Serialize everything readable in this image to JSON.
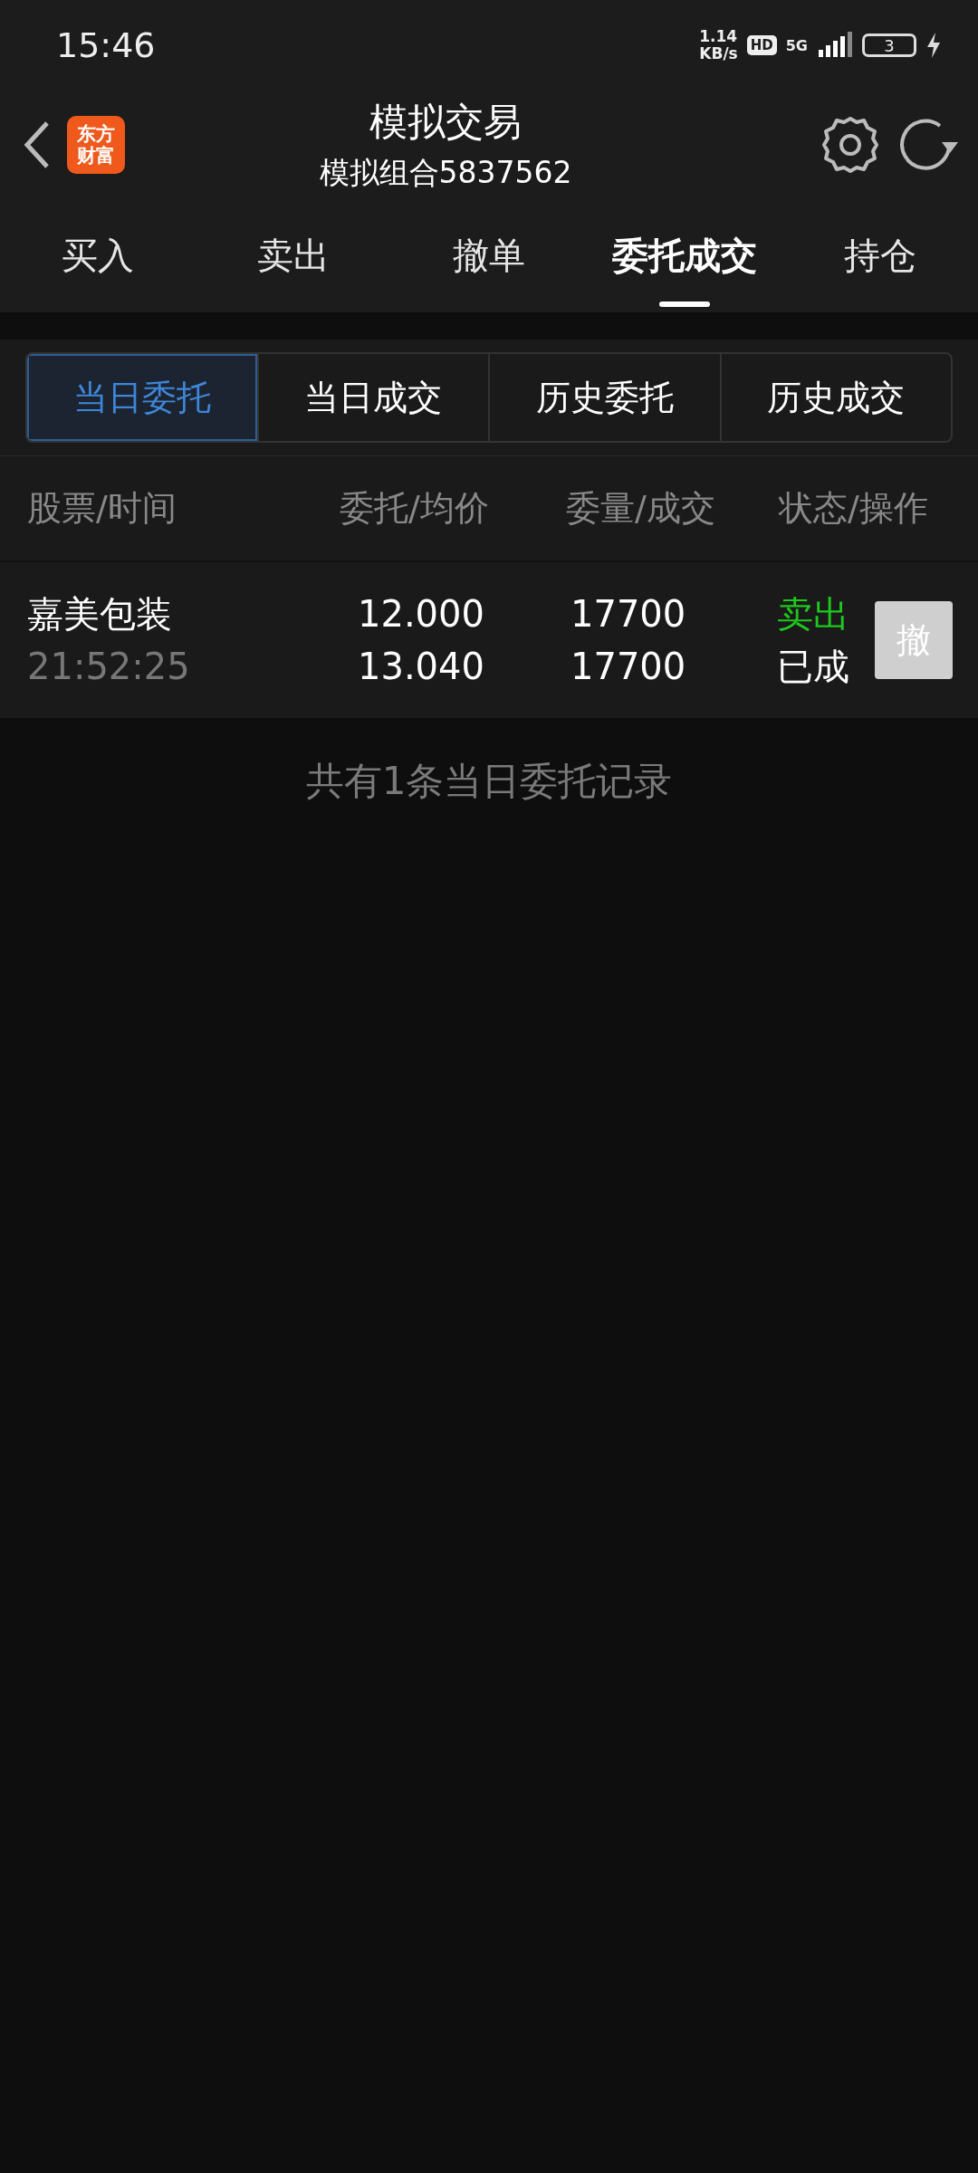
{
  "status_bar": {
    "time": "15:46",
    "net_speed": "1.14",
    "net_unit": "KB/s",
    "hd": "HD",
    "network": "5G",
    "battery": "3"
  },
  "header": {
    "logo": [
      "东方",
      "财富"
    ],
    "title": "模拟交易",
    "subtitle": "模拟组合5837562"
  },
  "tabs": [
    {
      "label": "买入",
      "selected": false
    },
    {
      "label": "卖出",
      "selected": false
    },
    {
      "label": "撤单",
      "selected": false
    },
    {
      "label": "委托成交",
      "selected": true
    },
    {
      "label": "持仓",
      "selected": false
    }
  ],
  "segments": [
    {
      "label": "当日委托",
      "selected": true
    },
    {
      "label": "当日成交",
      "selected": false
    },
    {
      "label": "历史委托",
      "selected": false
    },
    {
      "label": "历史成交",
      "selected": false
    }
  ],
  "table": {
    "columns": [
      "股票/时间",
      "委托/均价",
      "委量/成交",
      "状态/操作"
    ],
    "rows": [
      {
        "stock": "嘉美包装",
        "time": "21:52:25",
        "order_price": "12.000",
        "avg_price": "13.040",
        "order_qty": "17700",
        "filled_qty": "17700",
        "side": "卖出",
        "kind": "sell",
        "status": "已成",
        "action": "撤"
      }
    ]
  },
  "footer": "共有1条当日委托记录"
}
